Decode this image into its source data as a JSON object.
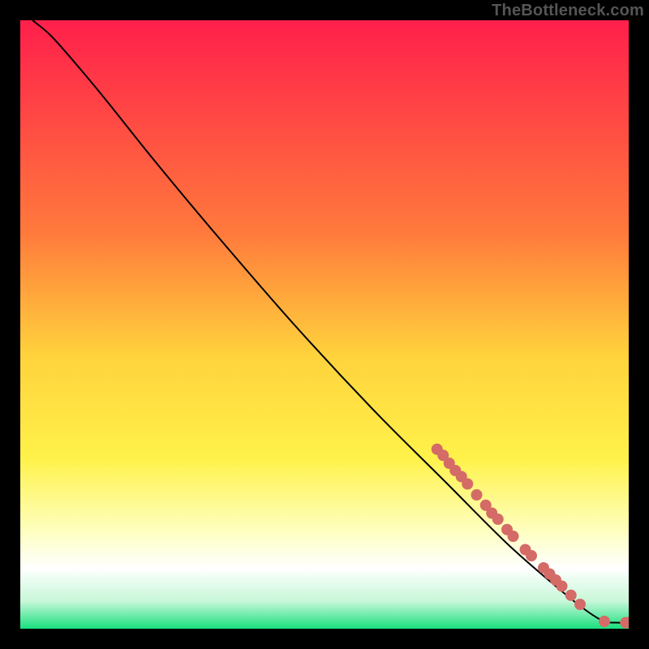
{
  "watermark": "TheBottleneck.com",
  "chart_data": {
    "type": "line",
    "title": "",
    "xlabel": "",
    "ylabel": "",
    "xlim": [
      0,
      100
    ],
    "ylim": [
      0,
      100
    ],
    "gradient_stops": [
      {
        "offset": 0,
        "color": "#ff1f4b"
      },
      {
        "offset": 0.35,
        "color": "#ff7a3c"
      },
      {
        "offset": 0.55,
        "color": "#ffd23c"
      },
      {
        "offset": 0.72,
        "color": "#fff24a"
      },
      {
        "offset": 0.84,
        "color": "#feffc0"
      },
      {
        "offset": 0.9,
        "color": "#ffffff"
      },
      {
        "offset": 0.955,
        "color": "#c7f7d8"
      },
      {
        "offset": 1.0,
        "color": "#18e07e"
      }
    ],
    "series": [
      {
        "name": "curve",
        "type": "line",
        "color": "#000000",
        "points": [
          {
            "x": 2.0,
            "y": 100.0
          },
          {
            "x": 5.0,
            "y": 97.5
          },
          {
            "x": 9.0,
            "y": 93.0
          },
          {
            "x": 14.0,
            "y": 87.0
          },
          {
            "x": 22.0,
            "y": 77.0
          },
          {
            "x": 32.0,
            "y": 65.0
          },
          {
            "x": 45.0,
            "y": 50.0
          },
          {
            "x": 58.0,
            "y": 36.0
          },
          {
            "x": 70.0,
            "y": 24.0
          },
          {
            "x": 80.0,
            "y": 14.0
          },
          {
            "x": 88.0,
            "y": 7.0
          },
          {
            "x": 93.0,
            "y": 3.0
          },
          {
            "x": 96.0,
            "y": 1.2
          },
          {
            "x": 98.0,
            "y": 1.0
          },
          {
            "x": 100.0,
            "y": 1.0
          }
        ]
      },
      {
        "name": "markers",
        "type": "scatter",
        "color": "#d46b66",
        "radius": 7,
        "points": [
          {
            "x": 68.5,
            "y": 29.5
          },
          {
            "x": 69.5,
            "y": 28.5
          },
          {
            "x": 70.5,
            "y": 27.2
          },
          {
            "x": 71.5,
            "y": 26.0
          },
          {
            "x": 72.5,
            "y": 25.0
          },
          {
            "x": 73.5,
            "y": 23.8
          },
          {
            "x": 75.0,
            "y": 22.0
          },
          {
            "x": 76.5,
            "y": 20.3
          },
          {
            "x": 77.5,
            "y": 19.0
          },
          {
            "x": 78.5,
            "y": 18.0
          },
          {
            "x": 80.0,
            "y": 16.3
          },
          {
            "x": 81.0,
            "y": 15.2
          },
          {
            "x": 83.0,
            "y": 13.0
          },
          {
            "x": 84.0,
            "y": 12.0
          },
          {
            "x": 86.0,
            "y": 10.0
          },
          {
            "x": 87.0,
            "y": 9.0
          },
          {
            "x": 88.0,
            "y": 8.0
          },
          {
            "x": 89.0,
            "y": 7.0
          },
          {
            "x": 90.5,
            "y": 5.5
          },
          {
            "x": 92.0,
            "y": 4.0
          },
          {
            "x": 96.0,
            "y": 1.2
          },
          {
            "x": 99.5,
            "y": 1.0
          },
          {
            "x": 100.0,
            "y": 1.0
          }
        ]
      }
    ]
  }
}
